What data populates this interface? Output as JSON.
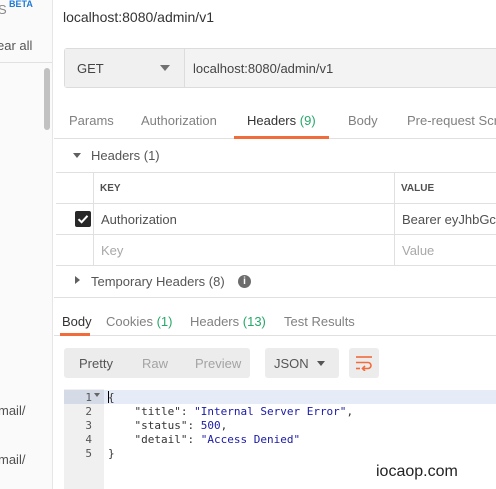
{
  "sidebar": {
    "beta_prefix": "S",
    "beta_badge": "BETA",
    "clear_all_label": "ear all",
    "history_item_1": "mail/",
    "history_item_2": "mail/"
  },
  "tab": {
    "title": "localhost:8080/admin/v1"
  },
  "request": {
    "method": "GET",
    "url": "localhost:8080/admin/v1"
  },
  "request_tabs": [
    {
      "label": "Params",
      "count": ""
    },
    {
      "label": "Authorization",
      "count": ""
    },
    {
      "label": "Headers",
      "count": "(9)"
    },
    {
      "label": "Body",
      "count": ""
    },
    {
      "label": "Pre-request Scri",
      "count": ""
    }
  ],
  "headers_section": {
    "title": "Headers (1)",
    "columns": {
      "key": "KEY",
      "value": "VALUE"
    },
    "rows": [
      {
        "checked": true,
        "key": "Authorization",
        "value": "Bearer eyJhbGciO"
      }
    ],
    "placeholder": {
      "key": "Key",
      "value": "Value"
    }
  },
  "temp_headers": {
    "title": "Temporary Headers (8)",
    "info_icon": "i"
  },
  "response_tabs": [
    {
      "label": "Body",
      "count": ""
    },
    {
      "label": "Cookies",
      "count": "(1)"
    },
    {
      "label": "Headers",
      "count": "(13)"
    },
    {
      "label": "Test Results",
      "count": ""
    }
  ],
  "format": {
    "modes": [
      "Pretty",
      "Raw",
      "Preview"
    ],
    "active_mode": "Pretty",
    "language": "JSON",
    "wrap_icon": "wrap-lines-icon"
  },
  "code": {
    "line_numbers": [
      "1",
      "2",
      "3",
      "4",
      "5"
    ],
    "lines": [
      {
        "open": "{"
      },
      {
        "key": "\"title\"",
        "value": "\"Internal Server Error\"",
        "trail": ","
      },
      {
        "key": "\"status\"",
        "value": "500",
        "trail": ","
      },
      {
        "key": "\"detail\"",
        "value": "\"Access Denied\"",
        "trail": ""
      },
      {
        "close": "}"
      }
    ]
  },
  "watermark": "iocaop.com",
  "colors": {
    "accent": "#f26b3a",
    "count_green": "#26a869",
    "json_value": "#1a1aa6"
  }
}
